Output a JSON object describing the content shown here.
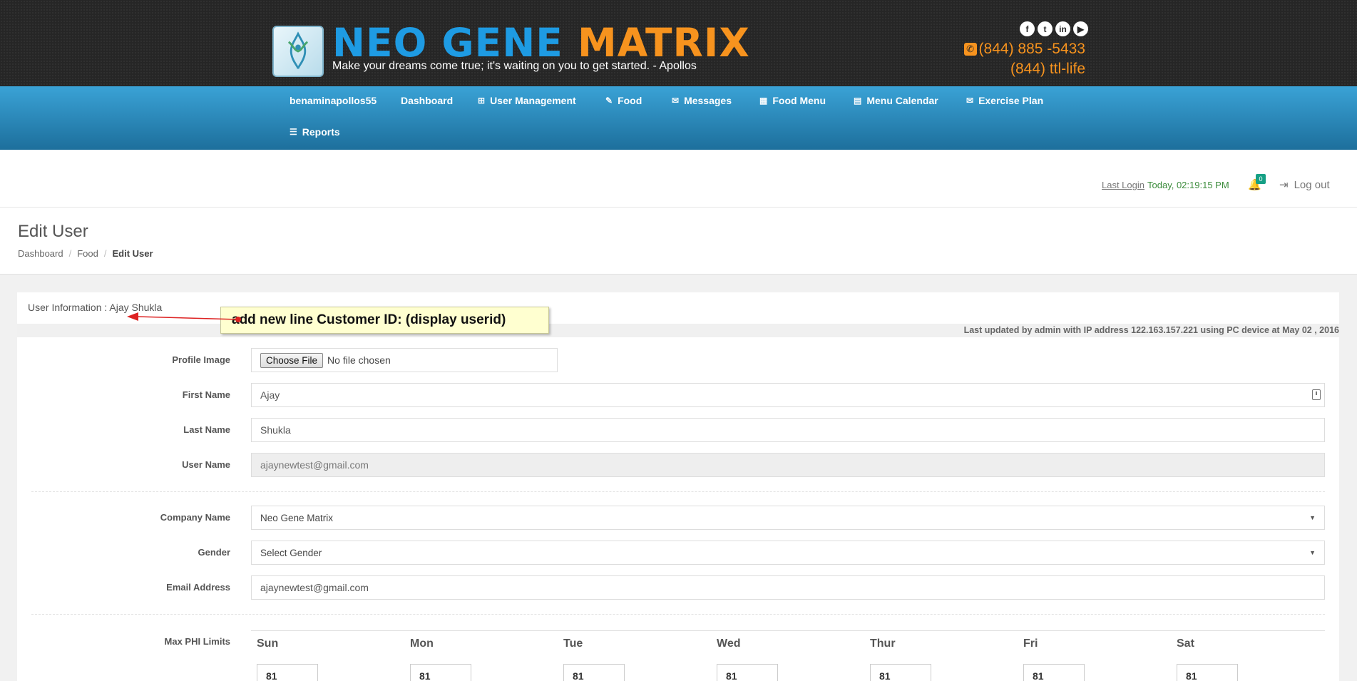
{
  "header": {
    "brand_part1": "NEO GENE",
    "brand_part2": "MATRIX",
    "tagline": "Make your dreams come true; it's waiting on you to get started.  -  Apollos",
    "social_icons": [
      "facebook-icon",
      "twitter-icon",
      "linkedin-icon",
      "youtube-icon"
    ],
    "phone1": "(844) 885 -5433",
    "phone2": "(844) ttl-life",
    "brand_colors": {
      "blue": "#1e9be3",
      "orange": "#f7931e"
    }
  },
  "nav": {
    "items": [
      {
        "label": "benaminapollos55",
        "icon": ""
      },
      {
        "label": "Dashboard",
        "icon": ""
      },
      {
        "label": "User Management",
        "icon": "sitemap-icon"
      },
      {
        "label": "Food",
        "icon": "edit-icon"
      },
      {
        "label": "Messages",
        "icon": "envelope-icon"
      },
      {
        "label": "Food Menu",
        "icon": "table-icon"
      },
      {
        "label": "Menu Calendar",
        "icon": "calendar-icon"
      },
      {
        "label": "Exercise Plan",
        "icon": "envelope-icon"
      },
      {
        "label": "Reports",
        "icon": "sliders-icon"
      }
    ]
  },
  "topbar": {
    "last_login_label": "Last Login",
    "last_login_value": "Today, 02:19:15 PM",
    "notification_count": "0",
    "logout_label": "Log out"
  },
  "page": {
    "title": "Edit User",
    "breadcrumb": [
      "Dashboard",
      "Food",
      "Edit User"
    ]
  },
  "panel": {
    "title": "User Information : Ajay Shukla",
    "updated_text": "Last updated by admin with IP address 122.163.157.221 using PC device at May 02 , 2016",
    "callout": "add new line Customer ID: (display userid)"
  },
  "form": {
    "profile_image_label": "Profile Image",
    "file_button": "Choose File",
    "file_status": "No file chosen",
    "first_name_label": "First Name",
    "first_name": "Ajay",
    "last_name_label": "Last Name",
    "last_name": "Shukla",
    "username_label": "User Name",
    "username": "ajaynewtest@gmail.com",
    "company_label": "Company Name",
    "company": "Neo Gene Matrix",
    "gender_label": "Gender",
    "gender": "Select Gender",
    "email_label": "Email Address",
    "email": "ajaynewtest@gmail.com",
    "phi_label": "Max PHI Limits"
  },
  "phi": {
    "days": [
      "Sun",
      "Mon",
      "Tue",
      "Wed",
      "Thur",
      "Fri",
      "Sat"
    ],
    "values": [
      "81",
      "81",
      "81",
      "81",
      "81",
      "81",
      "81"
    ]
  }
}
